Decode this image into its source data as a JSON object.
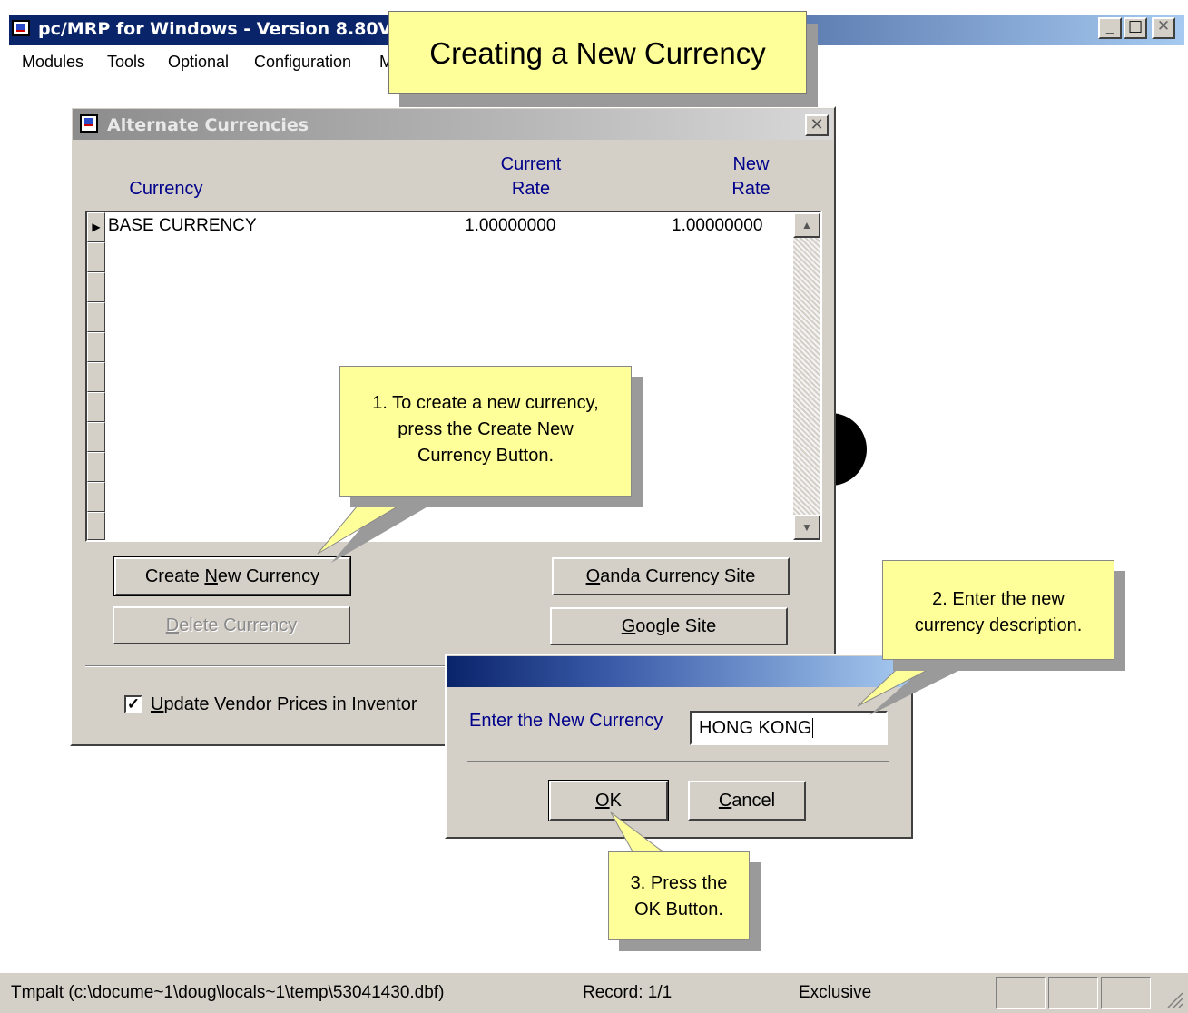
{
  "app": {
    "title": "pc/MRP for Windows - Version 8.80V",
    "min_glyph": "_",
    "max_glyph": "□",
    "close_glyph": "✕"
  },
  "menu": [
    "Modules",
    "Tools",
    "Optional",
    "Configuration",
    "M"
  ],
  "title_callout": "Creating a New Currency",
  "currencies_dialog": {
    "title": "Alternate Currencies",
    "close_glyph": "✕",
    "columns": {
      "currency": "Currency",
      "current_rate": [
        "Current",
        "Rate"
      ],
      "new_rate": [
        "New",
        "Rate"
      ]
    },
    "rows": [
      {
        "indicator": "▶",
        "currency": "BASE CURRENCY",
        "current_rate": "1.00000000",
        "new_rate": "1.00000000"
      }
    ],
    "scroll_up": "▲",
    "scroll_down": "▼",
    "buttons": {
      "create_pre": "Create ",
      "create_key": "N",
      "create_post": "ew Currency",
      "delete_key": "D",
      "delete_post": "elete Currency",
      "oanda_key": "O",
      "oanda_post": "anda Currency Site",
      "google_key": "G",
      "google_post": "oogle Site"
    },
    "checkbox": {
      "checked": true,
      "mark": "✓",
      "label_key": "U",
      "label_post": "pdate Vendor Prices in Inventor"
    }
  },
  "callout_1": [
    "1. To create a new currency,",
    "press the Create New",
    "Currency Button."
  ],
  "callout_2": [
    "2. Enter the new",
    "currency description."
  ],
  "callout_3": [
    "3. Press the",
    "OK Button."
  ],
  "new_currency_dialog": {
    "prompt": "Enter the New Currency",
    "value": "HONG KONG",
    "ok_key": "O",
    "ok_post": "K",
    "cancel_key": "C",
    "cancel_post": "ancel"
  },
  "status": {
    "file": "Tmpalt (c:\\docume~1\\doug\\locals~1\\temp\\53041430.dbf)",
    "record": "Record: 1/1",
    "mode": "Exclusive"
  }
}
